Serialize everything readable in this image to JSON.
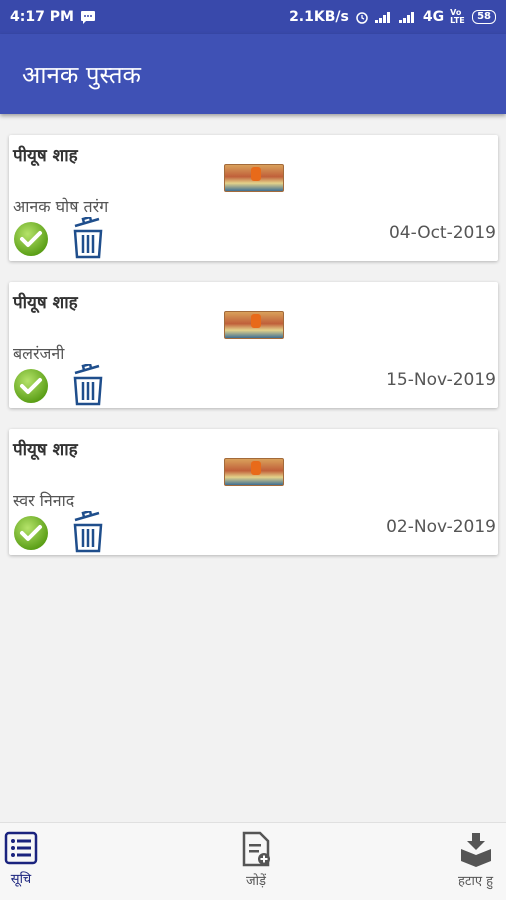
{
  "status_bar": {
    "time": "4:17 PM",
    "speed": "2.1KB/s",
    "network": "4G",
    "volte": "Vo LTE",
    "battery": "58"
  },
  "app_bar": {
    "title": "आनक पुस्तक"
  },
  "cards": [
    {
      "name": "पीयूष शाह",
      "title": "आनक घोष तरंग",
      "date": "04-Oct-2019"
    },
    {
      "name": "पीयूष शाह",
      "title": "बलरंजनी",
      "date": "15-Nov-2019"
    },
    {
      "name": "पीयूष शाह",
      "title": "स्वर निनाद",
      "date": "02-Nov-2019"
    }
  ],
  "bottom_nav": {
    "list_label": "सूचि",
    "add_label": "जोड़ें",
    "remove_label": "हटाए हु"
  },
  "icons": {
    "check": "check-circle-icon",
    "trash": "trash-icon",
    "list": "list-icon",
    "add": "add-document-icon",
    "remove": "remove-box-icon"
  },
  "colors": {
    "status_bar": "#3949ab",
    "app_bar": "#3f51b5",
    "check_green": "#7cbf2a",
    "trash_blue": "#1f4e8c",
    "nav_active": "#1a237e"
  }
}
